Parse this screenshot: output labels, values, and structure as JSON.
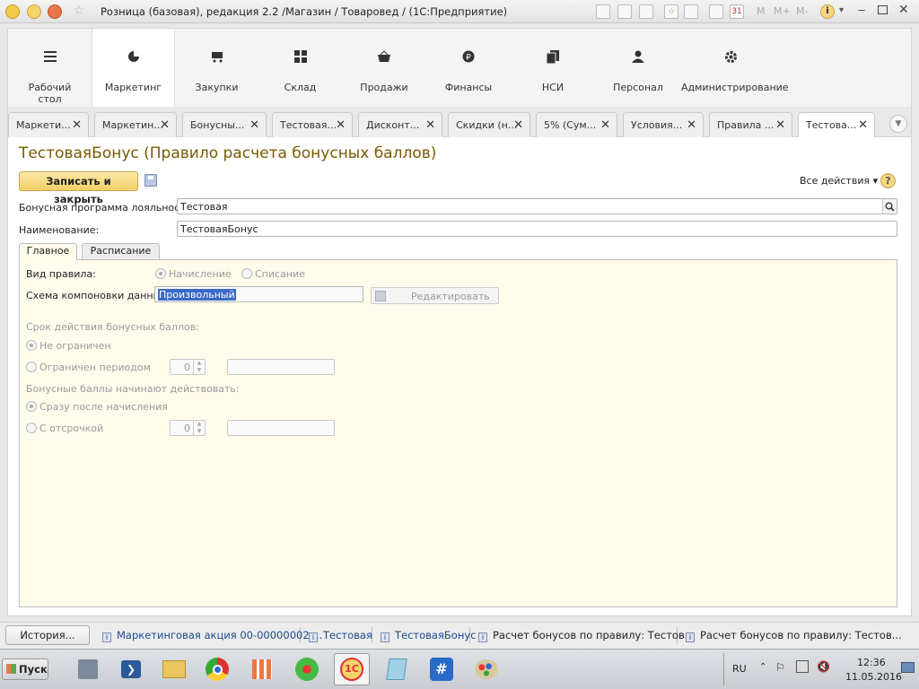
{
  "window": {
    "title": "Розница (базовая), редакция 2.2 /Магазин / Товаровед /  (1С:Предприятие)",
    "toolbar_m": [
      "M",
      "M+",
      "M-"
    ],
    "toolbar_calendar_day": "31"
  },
  "sections": [
    {
      "label": "Рабочий\nстол",
      "icon": "menu-lines-icon",
      "active": false
    },
    {
      "label": "Маркетинг",
      "icon": "pie-chart-icon",
      "active": true
    },
    {
      "label": "Закупки",
      "icon": "cart-icon",
      "active": false
    },
    {
      "label": "Склад",
      "icon": "grid-icon",
      "active": false
    },
    {
      "label": "Продажи",
      "icon": "basket-icon",
      "active": false
    },
    {
      "label": "Финансы",
      "icon": "ruble-icon",
      "active": false
    },
    {
      "label": "НСИ",
      "icon": "documents-icon",
      "active": false
    },
    {
      "label": "Персонал",
      "icon": "person-icon",
      "active": false
    },
    {
      "label": "Администрирование",
      "icon": "gear-icon",
      "active": false
    }
  ],
  "open_tabs": [
    {
      "label": "Маркети...",
      "active": false
    },
    {
      "label": "Маркетин...",
      "active": false
    },
    {
      "label": "Бонусны...",
      "active": false
    },
    {
      "label": "Тестовая...",
      "active": false
    },
    {
      "label": "Дисконт...",
      "active": false
    },
    {
      "label": "Скидки (н...",
      "active": false
    },
    {
      "label": "5% (Сум...",
      "active": false
    },
    {
      "label": "Условия...",
      "active": false
    },
    {
      "label": "Правила ...",
      "active": false
    },
    {
      "label": "Тестова...",
      "active": true
    }
  ],
  "form": {
    "title": "ТестоваяБонус (Правило расчета бонусных баллов)",
    "save_close_label": "Записать и закрыть",
    "all_actions_label": "Все действия ▾",
    "help_label": "?",
    "program_label": "Бонусная программа лояльности:",
    "program_value": "Тестовая",
    "name_label": "Наименование:",
    "name_value": "ТестоваяБонус",
    "tabs": [
      "Главное",
      "Расписание"
    ],
    "main": {
      "rule_type_label": "Вид правила:",
      "rule_type_options": [
        "Начисление",
        "Списание"
      ],
      "rule_type_selected": "Начисление",
      "schema_label": "Схема компоновки данных:",
      "schema_value": "Произвольный",
      "edit_button": "Редактировать",
      "validity_header": "Срок действия бонусных баллов:",
      "validity_unlimited": "Не ограничен",
      "validity_period": "Ограничен периодом",
      "validity_period_value": "0",
      "start_header": "Бонусные баллы начинают действовать:",
      "start_immediately": "Сразу после начисления",
      "start_delayed": "С отсрочкой",
      "start_delay_value": "0"
    }
  },
  "history": {
    "button": "История...",
    "items": [
      "Маркетинговая акция 00-00000002 ...",
      "Тестовая",
      "ТестоваяБонус",
      "Расчет бонусов по правилу: Тестов...",
      "Расчет бонусов по правилу: Тестов..."
    ]
  },
  "taskbar": {
    "start_label": "Пуск",
    "language": "RU",
    "time": "12:36",
    "date": "11.05.2016"
  }
}
